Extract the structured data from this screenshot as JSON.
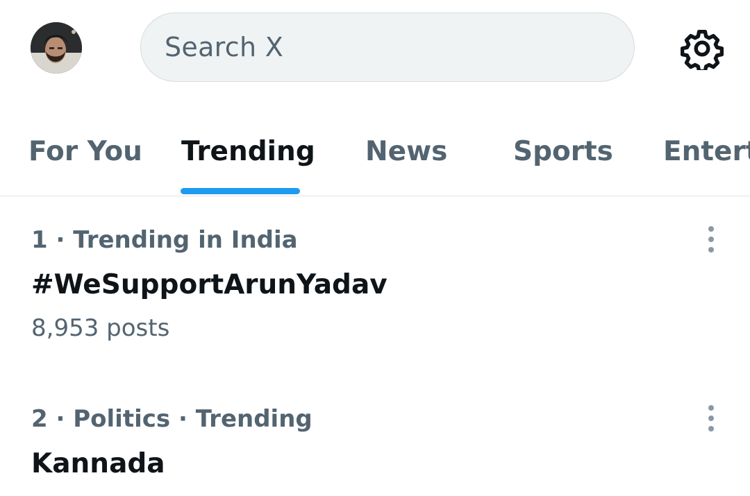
{
  "header": {
    "avatar_icon": "user-avatar",
    "search_placeholder": "Search X",
    "settings_icon": "gear-icon"
  },
  "tabs": [
    {
      "label": "For You",
      "active": false
    },
    {
      "label": "Trending",
      "active": true
    },
    {
      "label": "News",
      "active": false
    },
    {
      "label": "Sports",
      "active": false
    },
    {
      "label": "Entert",
      "active": false
    }
  ],
  "colors": {
    "accent": "#1d9bf0",
    "text_primary": "#0f1419",
    "text_secondary": "#536471",
    "search_bg": "#eff3f4"
  },
  "trends": [
    {
      "meta": "1 · Trending in India",
      "title": "#WeSupportArunYadav",
      "posts": "8,953 posts",
      "menu_icon": "more-vertical-icon"
    },
    {
      "meta": "2 · Politics · Trending",
      "title": "Kannada",
      "menu_icon": "more-vertical-icon"
    }
  ]
}
